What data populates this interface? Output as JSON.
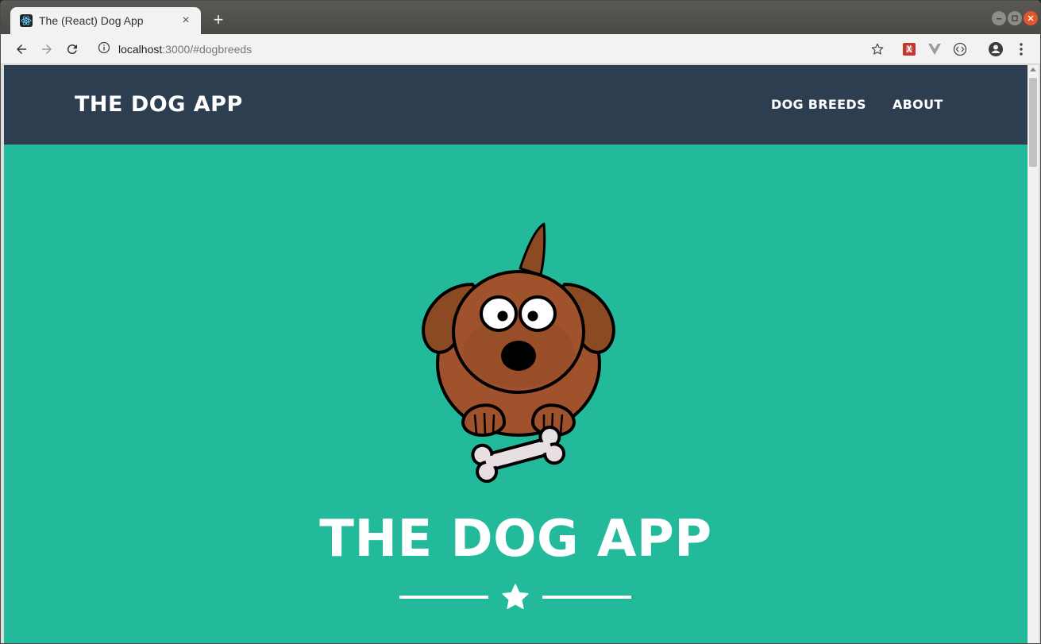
{
  "browser": {
    "tab_title": "The (React) Dog App",
    "tab_close": "×",
    "new_tab": "+",
    "url_host": "localhost",
    "url_rest": ":3000/#dogbreeds"
  },
  "navbar": {
    "brand": "THE DOG APP",
    "links": [
      "DOG BREEDS",
      "ABOUT"
    ]
  },
  "hero": {
    "title": "THE DOG APP"
  },
  "colors": {
    "navbar_bg": "#2c3e50",
    "hero_bg": "#22ba9b",
    "text": "#ffffff"
  },
  "icons": [
    "react-icon",
    "back-arrow-icon",
    "forward-arrow-icon",
    "reload-icon",
    "info-icon",
    "bookmark-star-icon",
    "extension-icon",
    "vue-devtools-icon",
    "code-icon",
    "account-icon",
    "menu-icon",
    "star-icon"
  ]
}
